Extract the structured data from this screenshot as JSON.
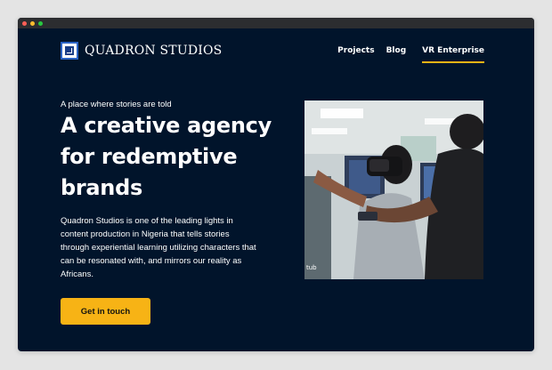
{
  "window": {
    "controls": [
      {
        "name": "close",
        "color": "#ff5f57"
      },
      {
        "name": "minimize",
        "color": "#febc2e"
      },
      {
        "name": "maximize",
        "color": "#28c840"
      }
    ]
  },
  "brand": {
    "name": "QUADRON STUDIOS"
  },
  "nav": {
    "items": [
      {
        "label": "Projects",
        "active": false
      },
      {
        "label": "Blog",
        "active": false
      },
      {
        "label": "VR Enterprise",
        "active": true
      }
    ]
  },
  "hero": {
    "tagline": "A place where stories are told",
    "headline": [
      "A creative agency",
      "for redemptive",
      "brands"
    ],
    "description": "Quadron Studios is one of the leading lights in content production in Nigeria that tells stories through experiential learning utilizing characters that can be resonated with, and mirrors our reality as Africans.",
    "cta_label": "Get in touch",
    "image_watermark": "tub"
  },
  "colors": {
    "background": "#01142b",
    "accent": "#f7b315",
    "text": "#ffffff"
  }
}
